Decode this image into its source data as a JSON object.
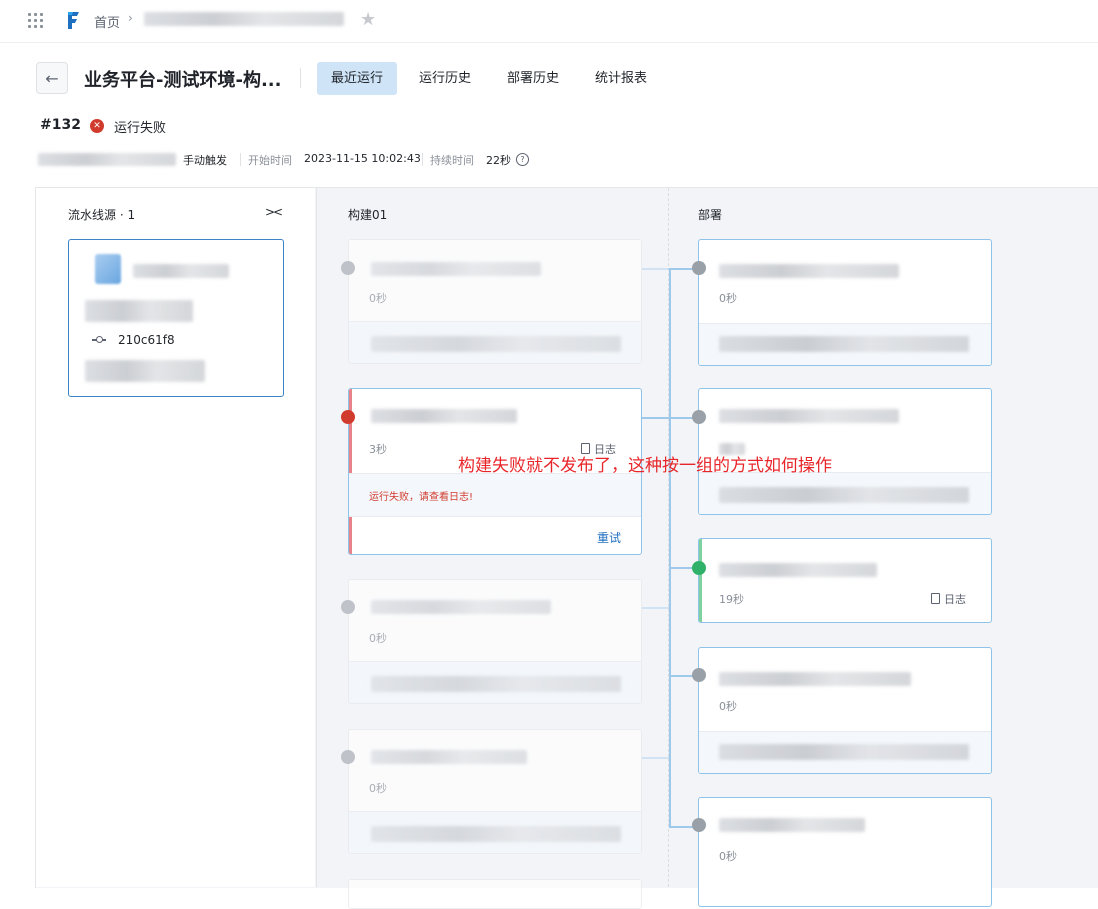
{
  "topbar": {
    "home": "首页",
    "sep": "›",
    "star": "★"
  },
  "header": {
    "back": "←",
    "title": "业务平台-测试环境-构...",
    "tabs": [
      "最近运行",
      "运行历史",
      "部署历史",
      "统计报表"
    ],
    "active_tab": "最近运行"
  },
  "run": {
    "number": "#132",
    "status": "运行失败",
    "status_icon": "✕",
    "trigger": "手动触发",
    "start_label": "开始时间",
    "start_time": "2023-11-15 10:02:43",
    "duration_label": "持续时间",
    "duration": "22秒",
    "help": "?"
  },
  "stages": {
    "source": {
      "label": "流水线源 · 1",
      "collapse": "><",
      "commit": "210c61f8"
    },
    "build": {
      "label": "构建01"
    },
    "deploy": {
      "label": "部署"
    }
  },
  "build_cards": [
    {
      "duration": "0秒",
      "status": "skipped"
    },
    {
      "duration": "3秒",
      "status": "failed",
      "log": "日志",
      "error": "运行失败，请查看日志!",
      "retry": "重试"
    },
    {
      "duration": "0秒",
      "status": "skipped"
    },
    {
      "duration": "0秒",
      "status": "skipped"
    }
  ],
  "deploy_cards": [
    {
      "duration": "0秒",
      "status": "skipped"
    },
    {
      "duration": "",
      "status": "skipped"
    },
    {
      "duration": "19秒",
      "status": "success",
      "log": "日志"
    },
    {
      "duration": "0秒",
      "status": "skipped"
    },
    {
      "duration": "0秒",
      "status": "skipped"
    }
  ],
  "annotation": "构建失败就不发布了，这种按一组的方式如何操作",
  "colors": {
    "accent": "#1f6fc0",
    "fail": "#d13b2d",
    "success": "#2fb16a",
    "annotation": "#e8262a"
  }
}
